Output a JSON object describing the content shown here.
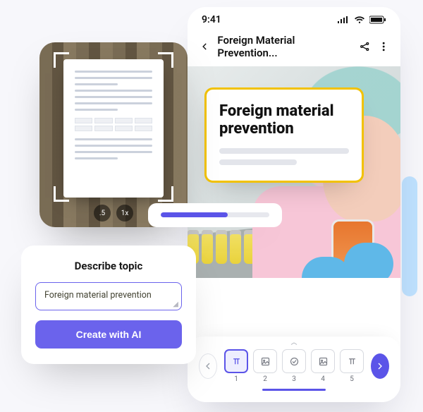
{
  "phone": {
    "status": {
      "time": "9:41"
    },
    "header": {
      "title": "Foreign Material Prevention..."
    },
    "title_card": {
      "heading": "Foreign material prevention"
    },
    "tray": {
      "slides": [
        {
          "num": "1"
        },
        {
          "num": "2"
        },
        {
          "num": "3"
        },
        {
          "num": "4"
        },
        {
          "num": "5"
        }
      ]
    }
  },
  "scanner": {
    "zoom_a": ".5",
    "zoom_b": "1x"
  },
  "progress": {
    "percent": 62
  },
  "topic": {
    "heading": "Describe topic",
    "value": "Foreign material prevention",
    "cta": "Create with AI"
  }
}
